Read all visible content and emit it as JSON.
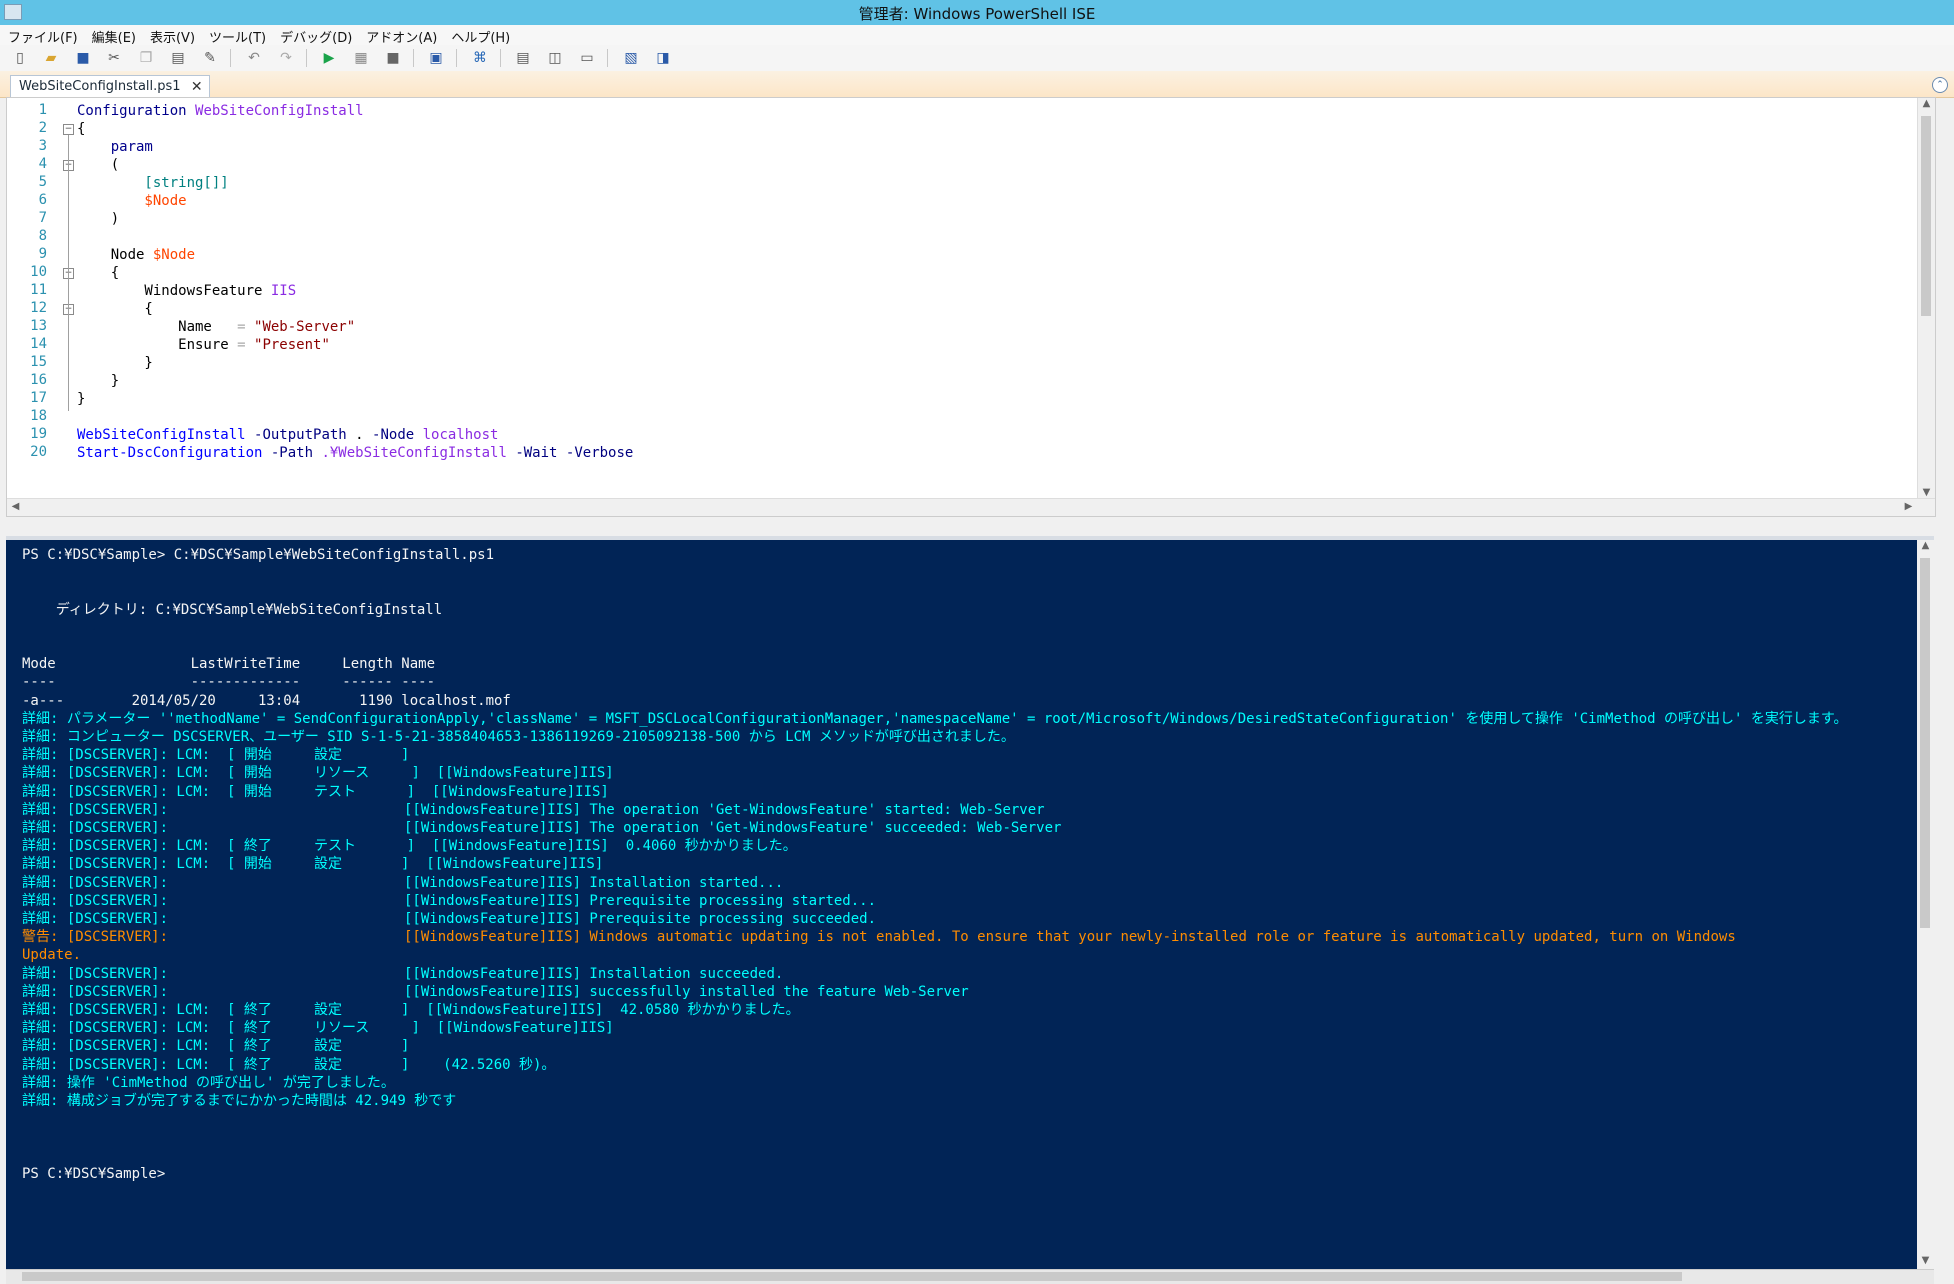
{
  "window": {
    "title": "管理者: Windows PowerShell ISE"
  },
  "menu": {
    "items": [
      "ファイル(F)",
      "編集(E)",
      "表示(V)",
      "ツール(T)",
      "デバッグ(D)",
      "アドオン(A)",
      "ヘルプ(H)"
    ]
  },
  "tab": {
    "filename": "WebSiteConfigInstall.ps1",
    "close": "✕"
  },
  "editor": {
    "line_numbers": [
      "1",
      "2",
      "3",
      "4",
      "5",
      "6",
      "7",
      "8",
      "9",
      "10",
      "11",
      "12",
      "13",
      "14",
      "15",
      "16",
      "17",
      "18",
      "19",
      "20"
    ],
    "lines": [
      "Configuration WebSiteConfigInstall",
      "{",
      "    param",
      "    (",
      "        [string[]]",
      "        $Node",
      "    )",
      "",
      "    Node $Node",
      "    {",
      "        WindowsFeature IIS",
      "        {",
      "            Name   = \"Web-Server\"",
      "            Ensure = \"Present\"",
      "        }",
      "    }",
      "}",
      "",
      "WebSiteConfigInstall -OutputPath . -Node localhost",
      "Start-DscConfiguration -Path .¥WebSiteConfigInstall -Wait -Verbose"
    ]
  },
  "console": {
    "lines": [
      {
        "t": "PS C:¥DSC¥Sample> C:¥DSC¥Sample¥WebSiteConfigInstall.ps1",
        "c": "n"
      },
      {
        "t": "",
        "c": "n"
      },
      {
        "t": "",
        "c": "n"
      },
      {
        "t": "    ディレクトリ: C:¥DSC¥Sample¥WebSiteConfigInstall",
        "c": "n"
      },
      {
        "t": "",
        "c": "n"
      },
      {
        "t": "",
        "c": "n"
      },
      {
        "t": "Mode                LastWriteTime     Length Name",
        "c": "n"
      },
      {
        "t": "----                -------------     ------ ----",
        "c": "n"
      },
      {
        "t": "-a---        2014/05/20     13:04       1190 localhost.mof",
        "c": "n"
      },
      {
        "t": "詳細: パラメーター ''methodName' = SendConfigurationApply,'className' = MSFT_DSCLocalConfigurationManager,'namespaceName' = root/Microsoft/Windows/DesiredStateConfiguration' を使用して操作 'CimMethod の呼び出し' を実行します。",
        "c": "v"
      },
      {
        "t": "詳細: コンピューター DSCSERVER、ユーザー SID S-1-5-21-3858404653-1386119269-2105092138-500 から LCM メソッドが呼び出されました。",
        "c": "v"
      },
      {
        "t": "詳細: [DSCSERVER]: LCM:  [ 開始     設定       ]",
        "c": "v"
      },
      {
        "t": "詳細: [DSCSERVER]: LCM:  [ 開始     リソース     ]  [[WindowsFeature]IIS]",
        "c": "v"
      },
      {
        "t": "詳細: [DSCSERVER]: LCM:  [ 開始     テスト      ]  [[WindowsFeature]IIS]",
        "c": "v"
      },
      {
        "t": "詳細: [DSCSERVER]:                            [[WindowsFeature]IIS] The operation 'Get-WindowsFeature' started: Web-Server",
        "c": "v"
      },
      {
        "t": "詳細: [DSCSERVER]:                            [[WindowsFeature]IIS] The operation 'Get-WindowsFeature' succeeded: Web-Server",
        "c": "v"
      },
      {
        "t": "詳細: [DSCSERVER]: LCM:  [ 終了     テスト      ]  [[WindowsFeature]IIS]  0.4060 秒かかりました。",
        "c": "v"
      },
      {
        "t": "詳細: [DSCSERVER]: LCM:  [ 開始     設定       ]  [[WindowsFeature]IIS]",
        "c": "v"
      },
      {
        "t": "詳細: [DSCSERVER]:                            [[WindowsFeature]IIS] Installation started...",
        "c": "v"
      },
      {
        "t": "詳細: [DSCSERVER]:                            [[WindowsFeature]IIS] Prerequisite processing started...",
        "c": "v"
      },
      {
        "t": "詳細: [DSCSERVER]:                            [[WindowsFeature]IIS] Prerequisite processing succeeded.",
        "c": "v"
      },
      {
        "t": "警告: [DSCSERVER]:                            [[WindowsFeature]IIS] Windows automatic updating is not enabled. To ensure that your newly-installed role or feature is automatically updated, turn on Windows",
        "c": "w"
      },
      {
        "t": "Update.",
        "c": "w"
      },
      {
        "t": "詳細: [DSCSERVER]:                            [[WindowsFeature]IIS] Installation succeeded.",
        "c": "v"
      },
      {
        "t": "詳細: [DSCSERVER]:                            [[WindowsFeature]IIS] successfully installed the feature Web-Server",
        "c": "v"
      },
      {
        "t": "詳細: [DSCSERVER]: LCM:  [ 終了     設定       ]  [[WindowsFeature]IIS]  42.0580 秒かかりました。",
        "c": "v"
      },
      {
        "t": "詳細: [DSCSERVER]: LCM:  [ 終了     リソース     ]  [[WindowsFeature]IIS]",
        "c": "v"
      },
      {
        "t": "詳細: [DSCSERVER]: LCM:  [ 終了     設定       ]",
        "c": "v"
      },
      {
        "t": "詳細: [DSCSERVER]: LCM:  [ 終了     設定       ]    (42.5260 秒)。",
        "c": "v"
      },
      {
        "t": "詳細: 操作 'CimMethod の呼び出し' が完了しました。",
        "c": "v"
      },
      {
        "t": "詳細: 構成ジョブが完了するまでにかかった時間は 42.949 秒です",
        "c": "v"
      },
      {
        "t": "",
        "c": "n"
      },
      {
        "t": "",
        "c": "n"
      },
      {
        "t": "",
        "c": "n"
      },
      {
        "t": "PS C:¥DSC¥Sample>",
        "c": "n"
      }
    ]
  },
  "colors": {
    "titlebar": "#60c2e6",
    "console_bg": "#012456",
    "verbose": "#00ffff",
    "warning": "#ff8c00"
  }
}
